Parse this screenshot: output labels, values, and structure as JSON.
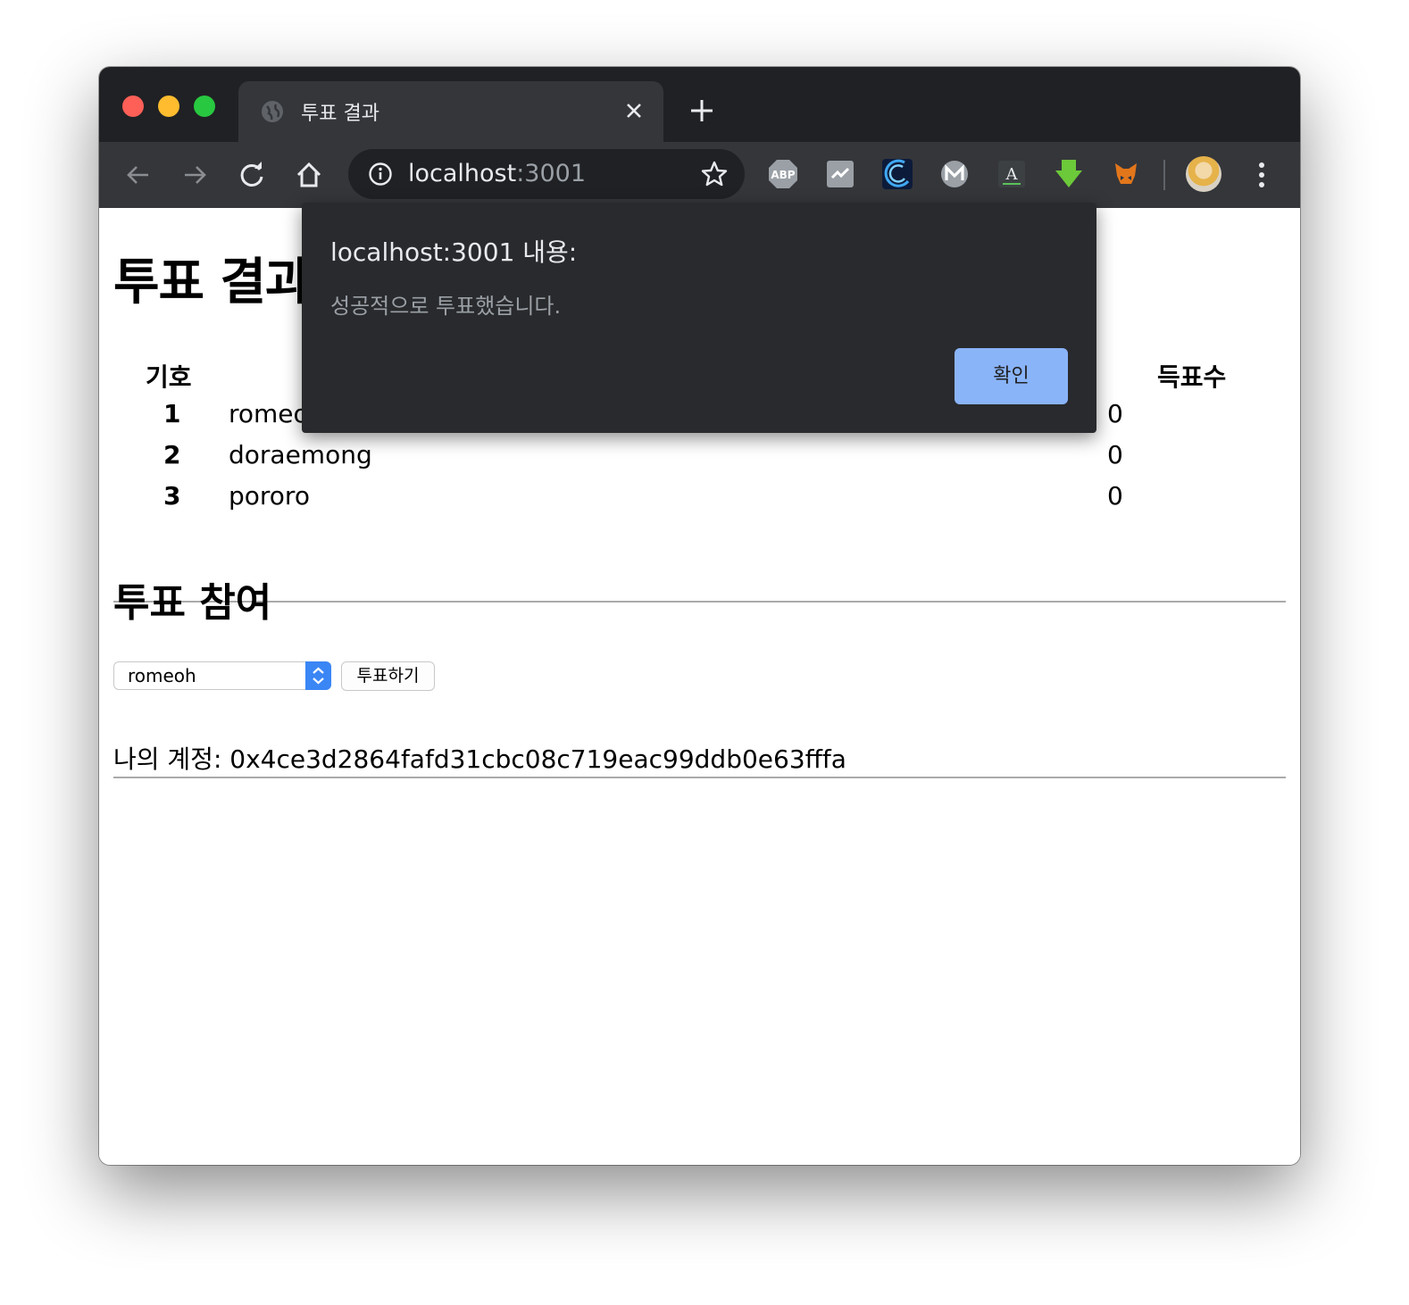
{
  "browser": {
    "tab_title": "투표 결과",
    "url_host": "localhost",
    "url_port": ":3001"
  },
  "page": {
    "title": "투표 결과",
    "table": {
      "headers": [
        "기호",
        "득표수"
      ],
      "rows": [
        {
          "num": "1",
          "name": "romeo",
          "votes": "0"
        },
        {
          "num": "2",
          "name": "doraemong",
          "votes": "0"
        },
        {
          "num": "3",
          "name": "pororo",
          "votes": "0"
        }
      ]
    },
    "vote_section_title": "투표 참여",
    "select_value": "romeoh",
    "vote_button_label": "투표하기",
    "account_label": "나의 계정: 0x4ce3d2864fafd31cbc08c719eac99ddb0e63fffa"
  },
  "dialog": {
    "title": "localhost:3001 내용:",
    "message": "성공적으로 투표했습니다.",
    "ok_label": "확인"
  },
  "icons": {
    "extensions": [
      "adblock-plus-icon",
      "chart-icon",
      "wave-icon",
      "monero-icon",
      "terminal-a-icon",
      "download-arrow-icon",
      "metamask-fox-icon"
    ]
  }
}
